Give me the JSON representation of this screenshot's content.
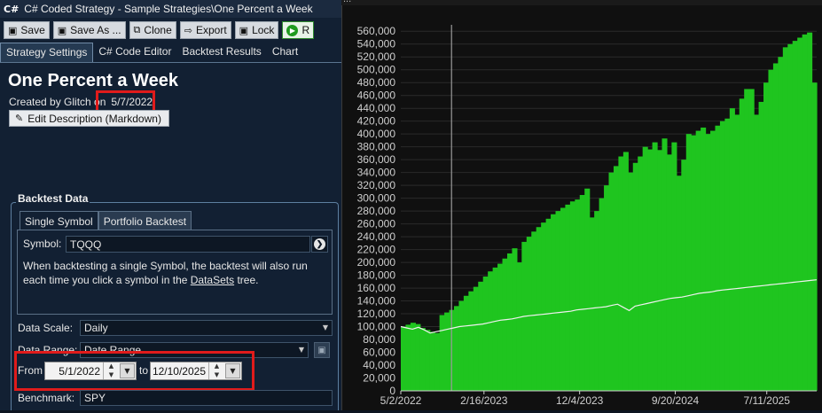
{
  "window": {
    "app_icon": "C#",
    "title": "C# Coded Strategy - Sample Strategies\\One Percent a Week"
  },
  "toolbar": {
    "save": "Save",
    "save_as": "Save As ...",
    "clone": "Clone",
    "export": "Export",
    "lock": "Lock",
    "run": "R"
  },
  "tabs": [
    "Strategy Settings",
    "C# Code Editor",
    "Backtest Results",
    "Chart"
  ],
  "strategy": {
    "name": "One Percent a Week",
    "created_by": "Created by Glitch on",
    "created_date": "5/7/2022",
    "edit_description": "Edit Description (Markdown)"
  },
  "backtest": {
    "group_label": "Backtest Data",
    "subtabs": [
      "Single Symbol",
      "Portfolio Backtest"
    ],
    "symbol_label": "Symbol:",
    "symbol_value": "TQQQ",
    "hint_part1": "When backtesting a single Symbol, the backtest will also run each time you click a symbol in the ",
    "hint_link": "DataSets",
    "hint_part2": " tree.",
    "data_scale_label": "Data Scale:",
    "data_scale_value": "Daily",
    "data_range_label": "Data Range:",
    "data_range_value": "Date Range",
    "from_label": "From",
    "from_date": "5/1/2022",
    "to_label": "to",
    "to_date": "12/10/2025",
    "benchmark_label": "Benchmark:",
    "benchmark_value": "SPY"
  },
  "chart_header": "...",
  "chart_data": {
    "type": "bar",
    "title": "",
    "xlabel": "",
    "ylabel": "",
    "ylim": [
      0,
      570000
    ],
    "y_ticks": [
      "0",
      "20,000",
      "40,000",
      "60,000",
      "80,000",
      "100,000",
      "120,000",
      "140,000",
      "160,000",
      "180,000",
      "200,000",
      "220,000",
      "240,000",
      "260,000",
      "280,000",
      "300,000",
      "320,000",
      "340,000",
      "360,000",
      "380,000",
      "400,000",
      "420,000",
      "440,000",
      "460,000",
      "480,000",
      "500,000",
      "520,000",
      "540,000",
      "560,000"
    ],
    "x_ticks": [
      "5/2/2022",
      "2/16/2023",
      "12/4/2023",
      "9/20/2024",
      "7/11/2025"
    ],
    "colors": {
      "equity_bars": "#1fc51f",
      "benchmark_line": "#f0f0f0",
      "background": "#101010",
      "grid": "#2a2a2a"
    },
    "series": [
      {
        "values": [
          100000,
          103000,
          106000,
          104000,
          98000,
          95000,
          92000,
          90000,
          118000,
          122000,
          126000,
          132000,
          140000,
          148000,
          155000,
          162000,
          170000,
          178000,
          186000,
          192000,
          198000,
          206000,
          214000,
          222000,
          200000,
          232000,
          240000,
          248000,
          255000,
          262000,
          268000,
          275000,
          280000,
          285000,
          290000,
          295000,
          298000,
          305000,
          315000,
          270000,
          280000,
          300000,
          320000,
          340000,
          350000,
          365000,
          372000,
          340000,
          355000,
          365000,
          380000,
          376000,
          387000,
          375000,
          393000,
          368000,
          387000,
          335000,
          360000,
          400000,
          398000,
          405000,
          410000,
          400000,
          405000,
          413000,
          420000,
          424000,
          440000,
          430000,
          455000,
          470000,
          470000,
          430000,
          450000,
          480000,
          500000,
          510000,
          520000,
          535000,
          540000,
          545000,
          550000,
          555000,
          558000,
          480000
        ]
      },
      {
        "values": [
          100000,
          98000,
          96000,
          99000,
          95000,
          90000,
          92000,
          94000,
          96000,
          98000,
          100000,
          101000,
          102000,
          103000,
          104000,
          106000,
          108000,
          110000,
          111000,
          112000,
          114000,
          116000,
          117000,
          118000,
          119000,
          120000,
          121000,
          122000,
          123000,
          124000,
          126000,
          127000,
          128000,
          129000,
          130000,
          131000,
          133000,
          135000,
          130000,
          125000,
          132000,
          134000,
          136000,
          138000,
          140000,
          142000,
          144000,
          145000,
          146000,
          148000,
          150000,
          152000,
          153000,
          154000,
          156000,
          157000,
          158000,
          159000,
          160000,
          161000,
          162000,
          163000,
          164000,
          165000,
          166000,
          167000,
          168000,
          169000,
          170000,
          171000,
          172000,
          173000
        ]
      }
    ]
  }
}
